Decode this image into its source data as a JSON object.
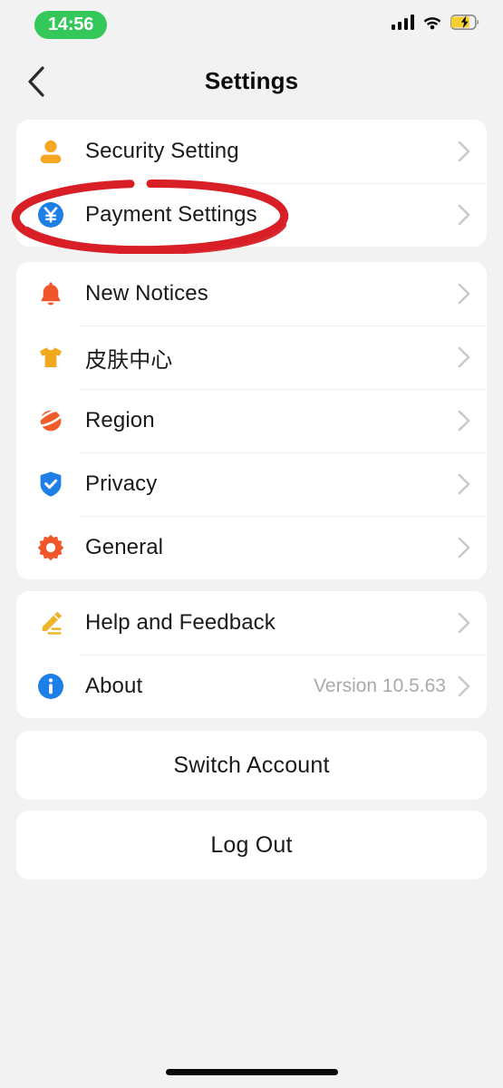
{
  "status_bar": {
    "time": "14:56",
    "time_pill_color": "#34c759",
    "signal_icon": "cellular-signal-icon",
    "wifi_icon": "wifi-icon",
    "battery_icon": "battery-charging-icon",
    "battery_color": "#f5cf2e"
  },
  "nav": {
    "back_icon": "chevron-left-icon",
    "title": "Settings"
  },
  "groups": [
    {
      "id": "account",
      "rows": [
        {
          "label": "Security Setting",
          "icon": "person-icon",
          "icon_color": "#f5a623",
          "value": ""
        },
        {
          "label": "Payment Settings",
          "icon": "yen-circle-icon",
          "icon_color": "#1e7fe8",
          "value": ""
        }
      ]
    },
    {
      "id": "prefs",
      "rows": [
        {
          "label": "New Notices",
          "icon": "bell-icon",
          "icon_color": "#f1552a",
          "value": ""
        },
        {
          "label": "皮肤中心",
          "icon": "tshirt-icon",
          "icon_color": "#f0a81e",
          "value": ""
        },
        {
          "label": "Region",
          "icon": "planet-icon",
          "icon_color": "#f15b2a",
          "value": ""
        },
        {
          "label": "Privacy",
          "icon": "shield-check-icon",
          "icon_color": "#1e7fe8",
          "value": ""
        },
        {
          "label": "General",
          "icon": "gear-icon",
          "icon_color": "#f1552a",
          "value": ""
        }
      ]
    },
    {
      "id": "support",
      "rows": [
        {
          "label": "Help and Feedback",
          "icon": "pencil-icon",
          "icon_color": "#f0b429",
          "value": ""
        },
        {
          "label": "About",
          "icon": "info-circle-icon",
          "icon_color": "#1e7fe8",
          "value": "Version 10.5.63"
        }
      ]
    }
  ],
  "actions": {
    "switch_account_label": "Switch Account",
    "log_out_label": "Log Out"
  },
  "annotation": {
    "shape": "ellipse-highlight",
    "color": "#d81f26",
    "targets": "Payment Settings"
  },
  "colors": {
    "background": "#f2f2f2",
    "card": "#ffffff",
    "text_primary": "#1a1a1a",
    "text_secondary": "#aaaaaa",
    "chevron": "#c8c8c8"
  }
}
